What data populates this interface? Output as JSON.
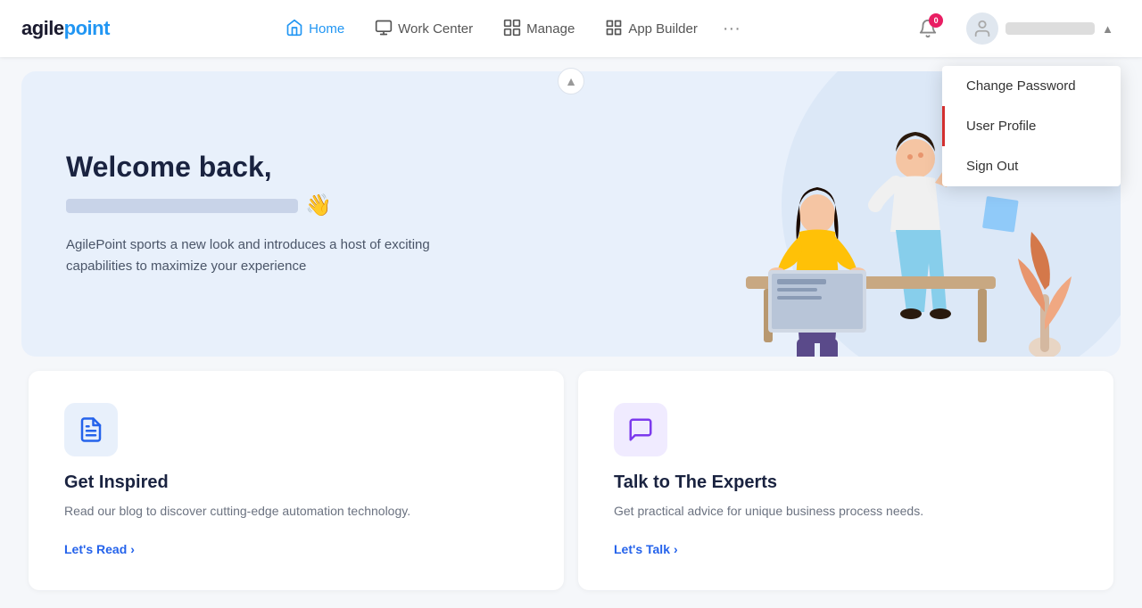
{
  "logo": {
    "agile": "agile",
    "point": "point"
  },
  "nav": {
    "items": [
      {
        "id": "home",
        "label": "Home",
        "icon": "🏠",
        "active": true
      },
      {
        "id": "workcenter",
        "label": "Work Center",
        "icon": "🖥",
        "active": false
      },
      {
        "id": "manage",
        "label": "Manage",
        "icon": "📋",
        "active": false
      },
      {
        "id": "appbuilder",
        "label": "App Builder",
        "icon": "⬛",
        "active": false
      }
    ],
    "more": "···"
  },
  "notifications": {
    "count": "0",
    "icon": "🔔"
  },
  "user": {
    "name_blurred": "••••••••••",
    "chevron": "▾"
  },
  "dropdown": {
    "items": [
      {
        "id": "change-password",
        "label": "Change Password",
        "active": false
      },
      {
        "id": "user-profile",
        "label": "User Profile",
        "active": true
      },
      {
        "id": "sign-out",
        "label": "Sign Out",
        "active": false
      }
    ]
  },
  "hero": {
    "title": "Welcome back,",
    "wave": "👋",
    "description": "AgilePoint sports a new look and introduces a host of exciting capabilities to maximize your experience"
  },
  "cards": [
    {
      "id": "get-inspired",
      "icon": "📰",
      "icon_type": "blue",
      "title": "Get Inspired",
      "description": "Read our blog to discover cutting-edge automation technology.",
      "link": "Let's Read",
      "link_arrow": "›"
    },
    {
      "id": "talk-to-experts",
      "icon": "💬",
      "icon_type": "purple",
      "title": "Talk to The Experts",
      "description": "Get practical advice for unique business process needs.",
      "link": "Let's Talk",
      "link_arrow": "›"
    }
  ]
}
